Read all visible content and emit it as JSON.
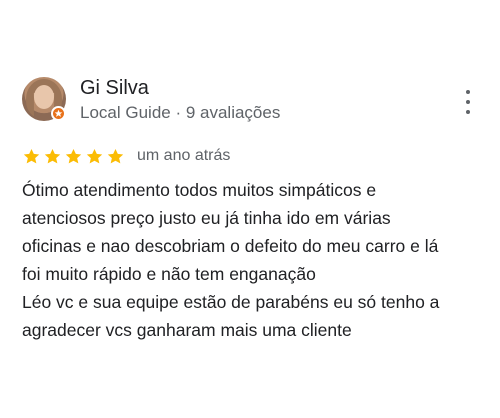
{
  "review": {
    "author_name": "Gi Silva",
    "author_meta": "Local Guide · 9 avaliações",
    "rating": 5,
    "rating_max": 5,
    "date": "um ano atrás",
    "text_lines": [
      "Ótimo atendimento todos muitos simpáticos e",
      "atenciosos preço justo eu já tinha ido em várias",
      "oficinas e nao descobriam o defeito do meu carro e lá",
      "foi muito rápido e não tem enganação",
      "Léo vc e sua equipe estão de parabéns eu só tenho a",
      "agradecer vcs ganharam mais uma cliente"
    ]
  },
  "icons": {
    "avatar": "profile-photo",
    "badge": "local-guide-badge-icon",
    "more": "more-vert-icon",
    "star": "star-icon"
  },
  "colors": {
    "star": "#fbbc04",
    "badge": "#e8711a",
    "text_primary": "#202124",
    "text_secondary": "#5f6368"
  }
}
